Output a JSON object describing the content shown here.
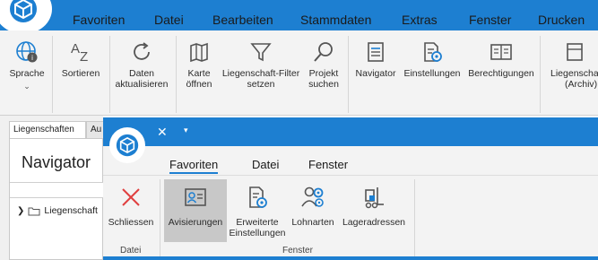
{
  "main_menu": {
    "items": [
      {
        "label": "Favoriten",
        "active": false
      },
      {
        "label": "Datei",
        "active": false
      },
      {
        "label": "Bearbeiten",
        "active": false
      },
      {
        "label": "Stammdaten",
        "active": false
      },
      {
        "label": "Extras",
        "active": true
      },
      {
        "label": "Fenster",
        "active": false
      },
      {
        "label": "Drucken",
        "active": false
      }
    ]
  },
  "ribbon": {
    "sprache": "Sprache",
    "sortieren": "Sortieren",
    "daten_line1": "Daten",
    "daten_line2": "aktualisieren",
    "karte_line1": "Karte",
    "karte_line2": "öffnen",
    "filter_line1": "Liegenschaft-Filter",
    "filter_line2": "setzen",
    "projekt_line1": "Projekt",
    "projekt_line2": "suchen",
    "navigator": "Navigator",
    "einstellungen": "Einstellungen",
    "berechtigungen": "Berechtigungen",
    "archiv_line1": "Liegenscha",
    "archiv_line2": "(Archiv)"
  },
  "left_pane": {
    "tab_active": "Liegenschaften",
    "tab_other": "Au",
    "title": "Navigator",
    "tree_item": "Liegenschaft"
  },
  "popup": {
    "menu": [
      {
        "label": "Favoriten",
        "active": true
      },
      {
        "label": "Datei",
        "active": false
      },
      {
        "label": "Fenster",
        "active": false
      }
    ],
    "buttons": {
      "schliessen": "Schliessen",
      "avisierungen": "Avisierungen",
      "erweiterte_line1": "Erweiterte",
      "erweiterte_line2": "Einstellungen",
      "lohnarten": "Lohnarten",
      "lageradressen": "Lageradressen"
    },
    "groups": {
      "datei": "Datei",
      "fenster": "Fenster"
    }
  },
  "colors": {
    "accent": "#1d7fd1",
    "close_red": "#e04040",
    "icon_gray": "#555555"
  }
}
